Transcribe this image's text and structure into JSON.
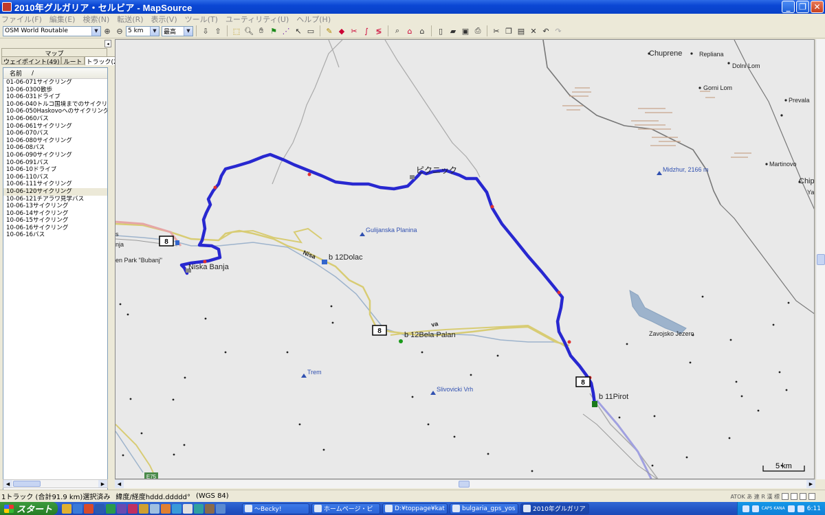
{
  "window": {
    "title": "2010年グルガリア・セルビア - MapSource",
    "minimize": "_",
    "maximize": "❐",
    "close": "✕"
  },
  "menu": [
    "ファイル(F)",
    "編集(E)",
    "検索(N)",
    "転送(R)",
    "表示(V)",
    "ツール(T)",
    "ユーティリティ(U)",
    "ヘルプ(H)"
  ],
  "toolbar": {
    "map_product": "OSM World Routable",
    "zoom_scale": "5 km",
    "detail": "最高"
  },
  "panel": {
    "map_tab": "マップ",
    "tabs": [
      "ウェイポイント(49)",
      "ルート",
      "トラック(22)"
    ],
    "column_name": "名前",
    "column_sort": "/",
    "collapse": "◂",
    "tracks": [
      "01-06-071サイクリング",
      "10-06-0300散歩",
      "10-06-031ドライブ",
      "10-06-040トルコ国境までのサイクリング",
      "10-06-050Haskovoへのサイクリング",
      "10-06-060バス",
      "10-06-061サイクリング",
      "10-06-070バス",
      "10-06-080サイクリング",
      "10-06-08バス",
      "10-06-090サイクリング",
      "10-06-091バス",
      "10-06-10ドライブ",
      "10-06-110バス",
      "10-06-111サイクリング",
      "10-06-120サイクリング",
      "10-06-121チアラワ見学バス",
      "10-06-13サイクリング",
      "10-06-14サイクリング",
      "10-06-15サイクリング",
      "10-06-16サイクリング",
      "10-06-16バス"
    ],
    "selected_index": 15
  },
  "map": {
    "places": {
      "chuprene": "Chuprene",
      "repliana": "Repliana",
      "dolni_lom": "Dolni Lom",
      "gorni_lom": "Gorni Lom",
      "prevala": "Prevala",
      "martinovo": "Martinovo",
      "chip": "Chip",
      "ya": "Ya",
      "midzhur": "Midzhur, 2166 m",
      "zavojsko": "Zavojsko Jezero",
      "gulijanska": "Gulijanska Planina",
      "trem": "Trem",
      "slivovicki": "Slivovicki Vrh",
      "niska_banja": "Niska Banja",
      "park_bubanj": "en Park \"Bubanj\"",
      "nja": "nja",
      "s": "s",
      "nisava": "Nisa",
      "va": "va"
    },
    "waypoints": {
      "picnic": "ピクニック",
      "dolac": "b 12Dolac",
      "bela_palanka": "b 12Bela Palan",
      "pirot": "b 11Pirot"
    },
    "road_shields": [
      "8",
      "8",
      "8"
    ],
    "highway_label": "E75",
    "scale_label": "5 km"
  },
  "status": {
    "selection": "1トラック (合計91.9 km)選択済み",
    "coord_format": "緯度/経度hddd.ddddd°",
    "datum": "(WGS 84)",
    "ime": "ATOK  あ 連 R 漢 標"
  },
  "taskbar": {
    "start": "スタート",
    "buttons": [
      "～Becky!",
      "ホームページ・ビ",
      "D:¥toppage¥kat",
      "bulgaria_gps_yos",
      "2010年グルガリア"
    ],
    "clock": "6:11",
    "caps": "CAPS KANA"
  }
}
